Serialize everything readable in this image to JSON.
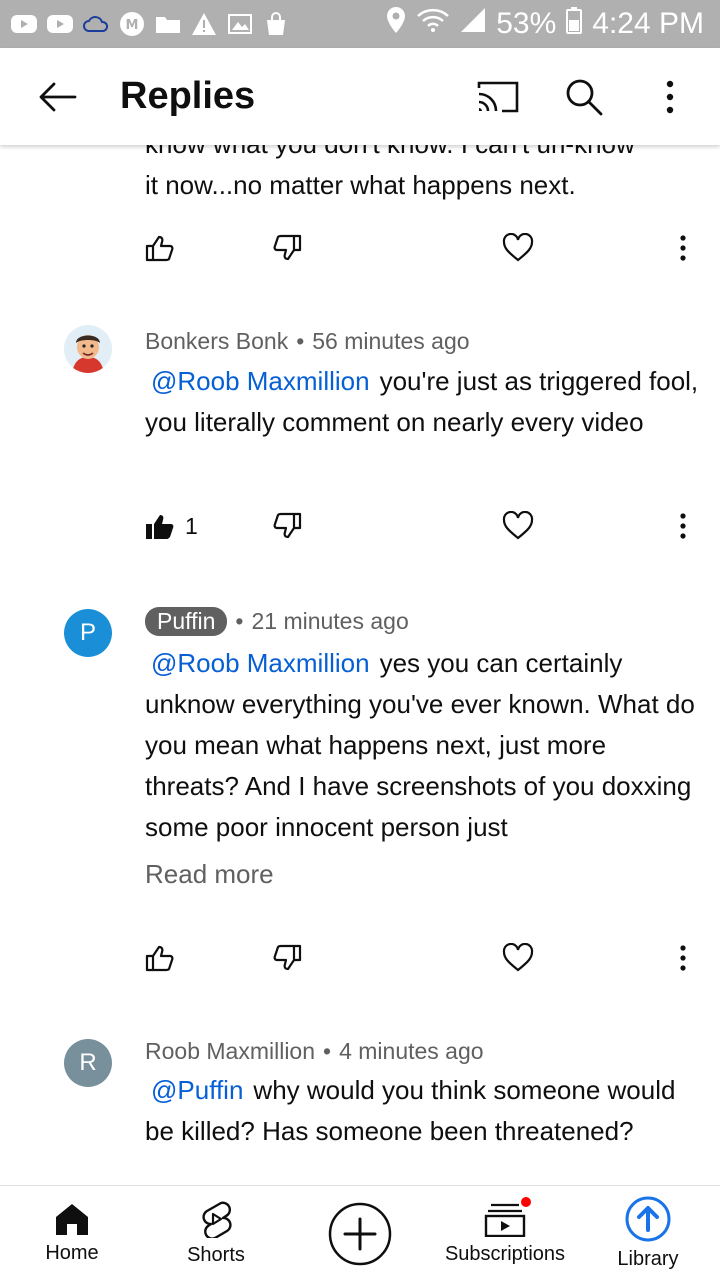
{
  "status_bar": {
    "battery": "53%",
    "time": "4:24 PM",
    "left_icons": [
      "youtube-icon",
      "youtube-icon",
      "cloud-icon",
      "medium-icon",
      "folder-icon",
      "warning-icon",
      "image-icon",
      "shopping-bag-icon"
    ],
    "right_icons": [
      "location-icon",
      "wifi-icon",
      "signal-icon",
      "battery-icon"
    ]
  },
  "header": {
    "title": "Replies",
    "icons": [
      "back-arrow-icon",
      "cast-icon",
      "search-icon",
      "more-vertical-icon"
    ]
  },
  "partial_comment": {
    "text_top": "know what you don't know.  I can't un-know",
    "text": "it now...no matter what happens next."
  },
  "comments": [
    {
      "author": "Bonkers Bonk",
      "time": "56 minutes ago",
      "avatar_type": "cartoon",
      "mention": "@Roob Maxmillion",
      "text": "you're just as triggered fool, you literally comment on nearly every video",
      "likes": "1",
      "liked": true
    },
    {
      "author": "Puffin",
      "author_is_chip": true,
      "time": "21 minutes ago",
      "avatar_letter": "P",
      "avatar_color": "#1a8fd8",
      "mention": "@Roob Maxmillion",
      "text": "yes you can certainly unknow everything you've ever known. What do you mean what happens next, just more threats? And I have screenshots of you doxxing some poor innocent person just",
      "read_more": "Read more"
    },
    {
      "author": "Roob Maxmillion",
      "time": "4 minutes ago",
      "avatar_letter": "R",
      "avatar_color": "#78909c",
      "mention": "@Puffin",
      "text": "why would you think someone would be killed? Has someone been threatened?"
    }
  ],
  "bottom_nav": [
    {
      "label": "Home",
      "icon": "home-icon"
    },
    {
      "label": "Shorts",
      "icon": "shorts-icon"
    },
    {
      "label": "",
      "icon": "create-plus-icon"
    },
    {
      "label": "Subscriptions",
      "icon": "subscriptions-icon"
    },
    {
      "label": "Library",
      "icon": "library-icon"
    }
  ],
  "colors": {
    "status_bar": "#b0b0b0",
    "mention": "#065fd4",
    "meta_text": "#606060",
    "library_accent": "#1a73e8",
    "notification_dot": "#ff0000"
  }
}
